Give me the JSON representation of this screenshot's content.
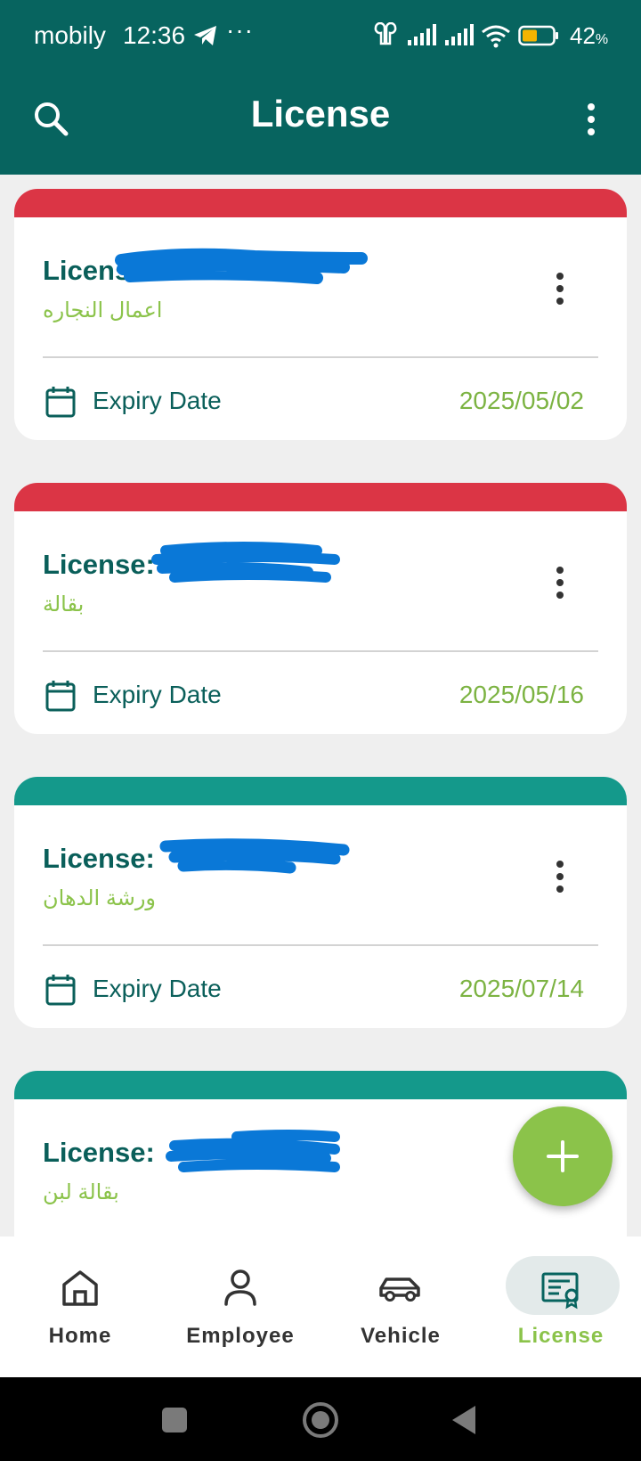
{
  "status_bar": {
    "carrier": "mobily",
    "time": "12:36",
    "battery_percent": "42",
    "battery_suffix": "%"
  },
  "app_bar": {
    "title": "License"
  },
  "licenses": [
    {
      "label": "License:",
      "activity": "اعمال النجاره",
      "expiry_label": "Expiry Date",
      "expiry_date": "2025/05/02",
      "status_color": "#db3545"
    },
    {
      "label": "License:",
      "activity": "بقالة",
      "expiry_label": "Expiry Date",
      "expiry_date": "2025/05/16",
      "status_color": "#db3545"
    },
    {
      "label": "License:",
      "activity": "ورشة الدهان",
      "expiry_label": "Expiry Date",
      "expiry_date": "2025/07/14",
      "status_color": "#14998b"
    },
    {
      "label": "License:",
      "activity": "بقالة لبن",
      "status_color": "#14998b"
    }
  ],
  "bottom_nav": [
    {
      "label": "Home",
      "icon": "home-icon"
    },
    {
      "label": "Employee",
      "icon": "person-icon"
    },
    {
      "label": "Vehicle",
      "icon": "car-icon"
    },
    {
      "label": "License",
      "icon": "certificate-icon",
      "active": true
    }
  ],
  "colors": {
    "primary": "#07645f",
    "accent": "#8bc34a",
    "expired": "#db3545",
    "valid": "#14998b"
  }
}
